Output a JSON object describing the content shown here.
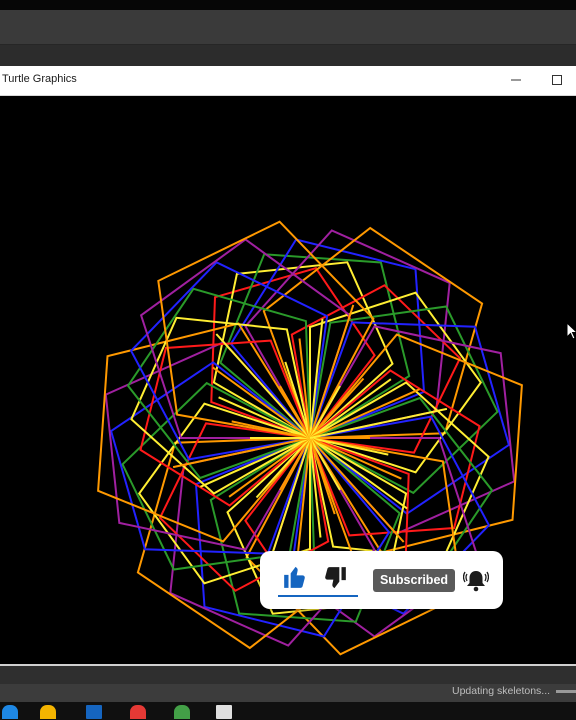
{
  "window": {
    "title": "Turtle Graphics",
    "minimize_icon": "minimize-icon",
    "maximize_icon": "maximize-icon"
  },
  "drawing": {
    "background": "#000000",
    "pattern": "spirograph of pentagons rotated around a center point",
    "colors": [
      "#ff1a1a",
      "#ffee33",
      "#2a9a2a",
      "#2222ff",
      "#a020a0",
      "#ff9900"
    ]
  },
  "overlay": {
    "subscribe_label": "Subscribed",
    "icons": [
      "thumbs-up-icon",
      "thumbs-down-icon",
      "bell-icon"
    ],
    "accent": "#1565c0"
  },
  "status": {
    "text": "Updating skeletons..."
  }
}
